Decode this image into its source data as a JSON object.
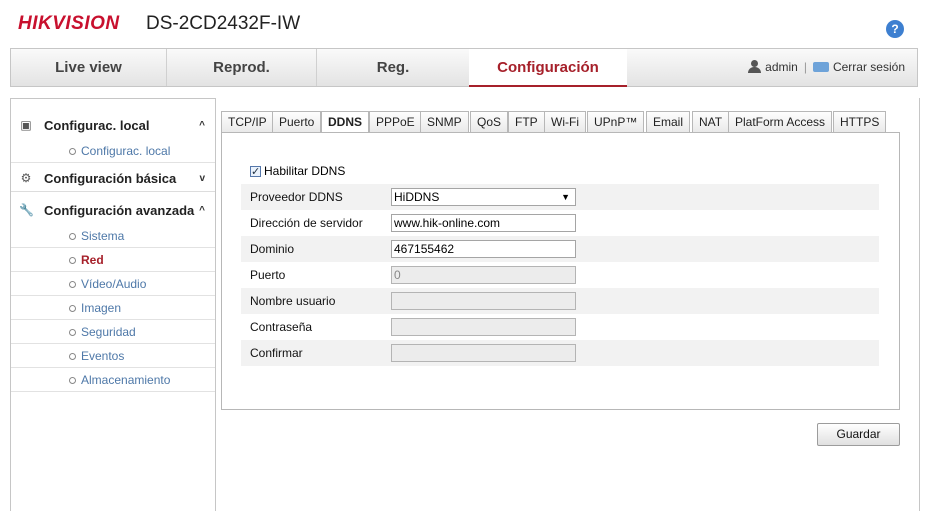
{
  "header": {
    "logo": "HIKVISION",
    "model": "DS-2CD2432F-IW",
    "help": "?"
  },
  "nav": {
    "tabs": [
      {
        "label": "Live view"
      },
      {
        "label": "Reprod."
      },
      {
        "label": "Reg."
      },
      {
        "label": "Configuración",
        "active": true
      }
    ],
    "user": "admin",
    "separator": "|",
    "logout": "Cerrar sesión"
  },
  "sidebar": {
    "local": {
      "label": "Configurac. local",
      "chevron": "^",
      "items": [
        {
          "label": "Configurac. local"
        }
      ]
    },
    "basic": {
      "label": "Configuración básica",
      "chevron": "v"
    },
    "advanced": {
      "label": "Configuración avanzada",
      "chevron": "^",
      "items": [
        {
          "label": "Sistema"
        },
        {
          "label": "Red",
          "active": true
        },
        {
          "label": "Vídeo/Audio"
        },
        {
          "label": "Imagen"
        },
        {
          "label": "Seguridad"
        },
        {
          "label": "Eventos"
        },
        {
          "label": "Almacenamiento"
        }
      ]
    }
  },
  "tabs": [
    {
      "label": "TCP/IP"
    },
    {
      "label": "Puerto"
    },
    {
      "label": "DDNS",
      "active": true
    },
    {
      "label": "PPPoE"
    },
    {
      "label": "SNMP"
    },
    {
      "label": "QoS"
    },
    {
      "label": "FTP"
    },
    {
      "label": "Wi-Fi"
    },
    {
      "label": "UPnP™"
    },
    {
      "label": "Email"
    },
    {
      "label": "NAT"
    },
    {
      "label": "PlatForm Access"
    },
    {
      "label": "HTTPS"
    }
  ],
  "form": {
    "enable_label": "Habilitar DDNS",
    "enable_checked": true,
    "fields": [
      {
        "label": "Proveedor DDNS",
        "value": "HiDDNS",
        "type": "select"
      },
      {
        "label": "Dirección de servidor",
        "value": "www.hik-online.com"
      },
      {
        "label": "Dominio",
        "value": "467155462"
      },
      {
        "label": "Puerto",
        "value": "0",
        "disabled": true
      },
      {
        "label": "Nombre usuario",
        "value": "",
        "disabled": true
      },
      {
        "label": "Contraseña",
        "value": "",
        "disabled": true
      },
      {
        "label": "Confirmar",
        "value": "",
        "disabled": true
      }
    ]
  },
  "actions": {
    "save": "Guardar"
  }
}
